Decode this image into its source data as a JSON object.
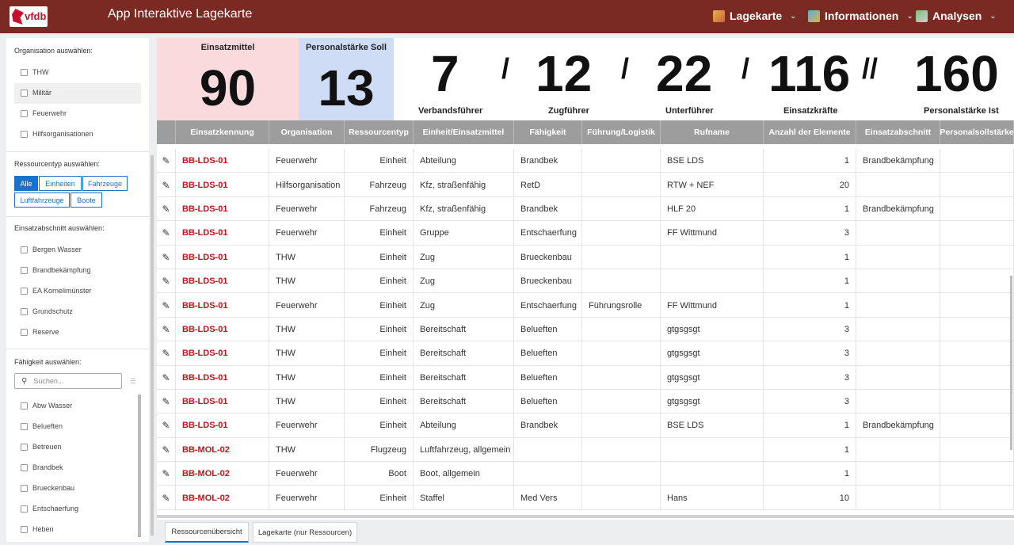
{
  "header": {
    "logo_text": "vfdb",
    "app_title": "App Interaktive Lagekarte",
    "menus": [
      {
        "label": "Lagekarte",
        "icon": "map-icon"
      },
      {
        "label": "Informationen",
        "icon": "info-map-icon"
      },
      {
        "label": "Analysen",
        "icon": "analysis-icon"
      }
    ]
  },
  "sidebar": {
    "org_title": "Organisation auswählen:",
    "orgs": [
      "THW",
      "Militär",
      "Feuerwehr",
      "Hilfsorganisationen"
    ],
    "res_title": "Ressourcentyp auswählen:",
    "res_types": [
      "Alle",
      "Einheiten",
      "Fahrzeuge",
      "Luftfahrzeuge",
      "Boote"
    ],
    "ea_title": "Einsatzabschnitt auswählen:",
    "eas": [
      "Bergen Wasser",
      "Brandbekämpfung",
      "EA Kornelimünster",
      "Grundschutz",
      "Reserve"
    ],
    "cap_title": "Fähigkeit auswählen:",
    "search_placeholder": "Suchen...",
    "caps": [
      "Abw Wasser",
      "Belueften",
      "Betreuen",
      "Brandbek",
      "Brueckenbau",
      "Entschaerfung",
      "Heben"
    ]
  },
  "kpis": {
    "einsatzmittel_label": "Einsatzmittel",
    "einsatzmittel_value": "90",
    "soll_label": "Personalstärke Soll",
    "soll_value": "13",
    "verband_value": "7",
    "verband_label": "Verbandsführer",
    "zug_value": "12",
    "zug_label": "Zugführer",
    "unter_value": "22",
    "unter_label": "Unterführer",
    "kraefte_value": "116",
    "kraefte_label": "Einsatzkräfte",
    "ist_value": "160",
    "ist_label": "Personalstärke Ist",
    "sep1": "/",
    "sep2": "/",
    "sep3": "/",
    "sep4": "//"
  },
  "table": {
    "headers": [
      "",
      "Einsatzkennung",
      "Organisation",
      "Ressourcentyp",
      "Einheit/Einsatzmittel",
      "Fähigkeit",
      "Führung/Logistik",
      "Rufname",
      "Anzahl der Elemente",
      "Einsatzabschnitt",
      "Personalsollstärke"
    ],
    "rows": [
      [
        "BB-LDS-01",
        "Feuerwehr",
        "Einheit",
        "Abteilung",
        "Brandbek",
        "",
        "BSE LDS",
        "1",
        "Brandbekämpfung",
        ""
      ],
      [
        "BB-LDS-01",
        "Hilfsorganisation",
        "Fahrzeug",
        "Kfz, straßenfähig",
        "RetD",
        "",
        "RTW + NEF",
        "20",
        "",
        ""
      ],
      [
        "BB-LDS-01",
        "Feuerwehr",
        "Fahrzeug",
        "Kfz, straßenfähig",
        "Brandbek",
        "",
        "HLF 20",
        "1",
        "Brandbekämpfung",
        ""
      ],
      [
        "BB-LDS-01",
        "Feuerwehr",
        "Einheit",
        "Gruppe",
        "Entschaerfung",
        "",
        "FF Wittmund",
        "3",
        "",
        ""
      ],
      [
        "BB-LDS-01",
        "THW",
        "Einheit",
        "Zug",
        "Brueckenbau",
        "",
        "",
        "1",
        "",
        ""
      ],
      [
        "BB-LDS-01",
        "THW",
        "Einheit",
        "Zug",
        "Brueckenbau",
        "",
        "",
        "1",
        "",
        ""
      ],
      [
        "BB-LDS-01",
        "Feuerwehr",
        "Einheit",
        "Zug",
        "Entschaerfung",
        "Führungsrolle",
        "FF Wittmund",
        "1",
        "",
        ""
      ],
      [
        "BB-LDS-01",
        "THW",
        "Einheit",
        "Bereitschaft",
        "Belueften",
        "",
        "gtgsgsgt",
        "3",
        "",
        ""
      ],
      [
        "BB-LDS-01",
        "THW",
        "Einheit",
        "Bereitschaft",
        "Belueften",
        "",
        "gtgsgsgt",
        "3",
        "",
        ""
      ],
      [
        "BB-LDS-01",
        "THW",
        "Einheit",
        "Bereitschaft",
        "Belueften",
        "",
        "gtgsgsgt",
        "3",
        "",
        ""
      ],
      [
        "BB-LDS-01",
        "THW",
        "Einheit",
        "Bereitschaft",
        "Belueften",
        "",
        "gtgsgsgt",
        "3",
        "",
        ""
      ],
      [
        "BB-LDS-01",
        "Feuerwehr",
        "Einheit",
        "Abteilung",
        "Brandbek",
        "",
        "BSE LDS",
        "1",
        "Brandbekämpfung",
        ""
      ],
      [
        "BB-MOL-02",
        "THW",
        "Flugzeug",
        "Luftfahrzeug, allgemein",
        "",
        "",
        "",
        "1",
        "",
        ""
      ],
      [
        "BB-MOL-02",
        "Feuerwehr",
        "Boot",
        "Boot, allgemein",
        "",
        "",
        "",
        "1",
        "",
        ""
      ],
      [
        "BB-MOL-02",
        "Feuerwehr",
        "Einheit",
        "Staffel",
        "Med Vers",
        "",
        "Hans",
        "10",
        "",
        ""
      ]
    ]
  },
  "tabs": [
    "Ressourcenübersicht",
    "Lagekarte (nur Ressourcen)"
  ],
  "colors": {
    "topbar": "#7a2a22",
    "accent": "#1a73c8",
    "id_red": "#c0161b"
  }
}
